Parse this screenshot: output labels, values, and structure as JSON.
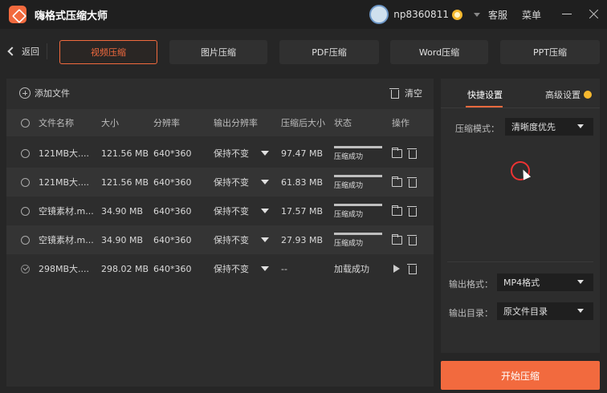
{
  "app": {
    "title": "嗨格式压缩大师",
    "username": "np8360811",
    "links": {
      "service": "客服",
      "menu": "菜单"
    }
  },
  "nav": {
    "back_label": "返回",
    "tabs": [
      {
        "label": "视频压缩",
        "active": true
      },
      {
        "label": "图片压缩",
        "active": false
      },
      {
        "label": "PDF压缩",
        "active": false
      },
      {
        "label": "Word压缩",
        "active": false
      },
      {
        "label": "PPT压缩",
        "active": false
      }
    ]
  },
  "file_panel": {
    "add_label": "添加文件",
    "clear_label": "清空",
    "columns": {
      "name": "文件名称",
      "size": "大小",
      "resolution": "分辨率",
      "out_resolution": "输出分辨率",
      "compressed_size": "压缩后大小",
      "status": "状态",
      "actions": "操作"
    },
    "rows": [
      {
        "name": "121MB大....",
        "size": "121.56 MB",
        "resolution": "640*360",
        "out_resolution": "保持不变",
        "compressed_size": "97.47 MB",
        "status": "压缩成功",
        "progress": 1.0,
        "checked": false
      },
      {
        "name": "121MB大....",
        "size": "121.56 MB",
        "resolution": "640*360",
        "out_resolution": "保持不变",
        "compressed_size": "61.83 MB",
        "status": "压缩成功",
        "progress": 1.0,
        "checked": false
      },
      {
        "name": "空镜素材.m...",
        "size": "34.90 MB",
        "resolution": "640*360",
        "out_resolution": "保持不变",
        "compressed_size": "17.57 MB",
        "status": "压缩成功",
        "progress": 1.0,
        "checked": false
      },
      {
        "name": "空镜素材.m...",
        "size": "34.90 MB",
        "resolution": "640*360",
        "out_resolution": "保持不变",
        "compressed_size": "27.93 MB",
        "status": "压缩成功",
        "progress": 1.0,
        "checked": false
      },
      {
        "name": "298MB大....",
        "size": "298.02 MB",
        "resolution": "640*360",
        "out_resolution": "保持不变",
        "compressed_size": "--",
        "status": "加载成功",
        "progress": 0,
        "checked": true
      }
    ]
  },
  "settings": {
    "tab_quick": "快捷设置",
    "tab_advanced": "高级设置",
    "mode_label": "压缩模式：",
    "mode_value": "清晰度优先",
    "format_label": "输出格式：",
    "format_value": "MP4格式",
    "dir_label": "输出目录：",
    "dir_value": "原文件目录"
  },
  "start_label": "开始压缩",
  "colors": {
    "accent": "#f26a3e",
    "vip": "#f5b82e"
  }
}
